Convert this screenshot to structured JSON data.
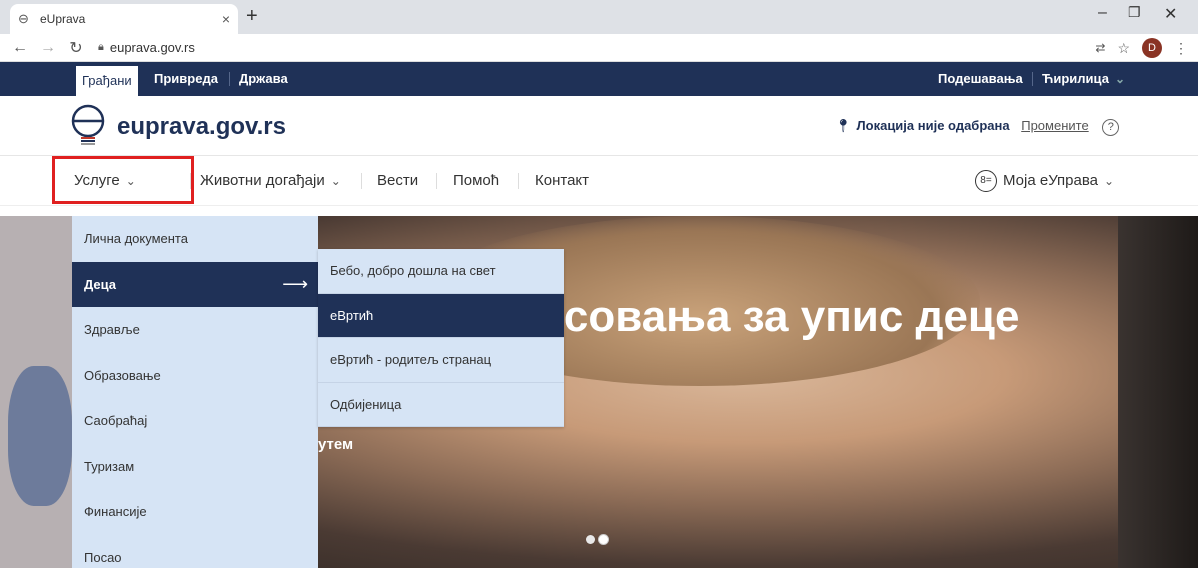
{
  "browser": {
    "tab_title": "eUprava",
    "tab_close": "×",
    "new_tab": "+",
    "url": "euprava.gov.rs",
    "avatar_letter": "D"
  },
  "topstrip": {
    "items": [
      "Грађани",
      "Привреда",
      "Држава"
    ],
    "settings": "Подешавања",
    "language": "Ћирилица"
  },
  "header": {
    "logo_text": "euprava.gov.rs",
    "location_label": "Локација није одабрана",
    "change_label": "Промените",
    "help_glyph": "?"
  },
  "nav": {
    "items": [
      "Услуге",
      "Животни догађаји",
      "Вести",
      "Помоћ",
      "Контакт"
    ],
    "account_icon_text": "8=",
    "account": "Моја еУправа"
  },
  "hero": {
    "title_fragment": "есовања за упис деце",
    "subtitle_fragment": "утем"
  },
  "menu_services": {
    "items": [
      "Лична документа",
      "Деца",
      "Здравље",
      "Образовање",
      "Саобраћај",
      "Туризам",
      "Финансије",
      "Посао"
    ],
    "active_index": 1
  },
  "menu_children": {
    "items": [
      "Бебо, добро дошла на свет",
      "еВртић",
      "еВртић - родитељ странац",
      "Одбијеница"
    ],
    "active_index": 1
  },
  "colors": {
    "brand_navy": "#1f3157",
    "menu_bg": "#d6e4f5",
    "highlight_red": "#e02020"
  }
}
